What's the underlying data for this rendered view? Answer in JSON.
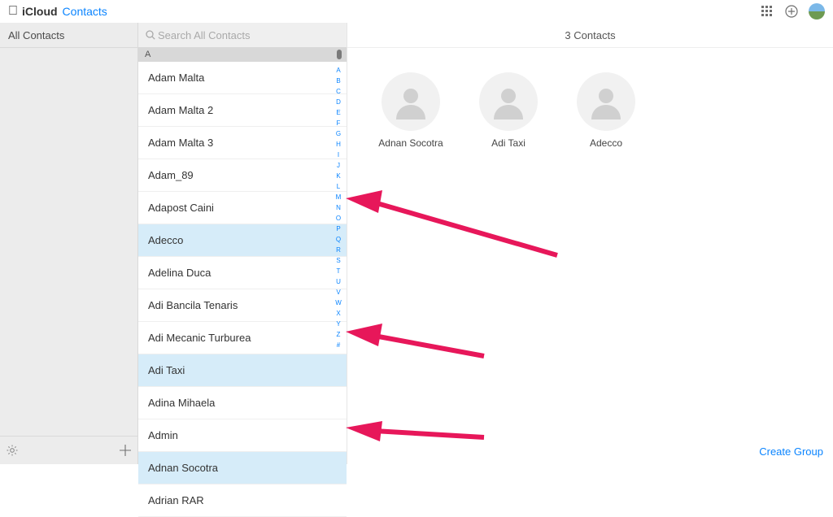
{
  "topbar": {
    "brand_os": "iCloud",
    "brand_app": "Contacts"
  },
  "sidebar": {
    "groups": [
      {
        "label": "All Contacts"
      }
    ]
  },
  "list": {
    "search_placeholder": "Search All Contacts",
    "section_header": "A",
    "rows": [
      {
        "name": "Adam Malta",
        "selected": false
      },
      {
        "name": "Adam Malta 2",
        "selected": false
      },
      {
        "name": "Adam Malta 3",
        "selected": false
      },
      {
        "name": "Adam_89",
        "selected": false
      },
      {
        "name": "Adapost Caini",
        "selected": false
      },
      {
        "name": "Adecco",
        "selected": true
      },
      {
        "name": "Adelina Duca",
        "selected": false
      },
      {
        "name": "Adi Bancila Tenaris",
        "selected": false
      },
      {
        "name": "Adi Mecanic Turburea",
        "selected": false
      },
      {
        "name": "Adi Taxi",
        "selected": true
      },
      {
        "name": "Adina Mihaela",
        "selected": false
      },
      {
        "name": "Admin",
        "selected": false
      },
      {
        "name": "Adnan Socotra",
        "selected": true
      },
      {
        "name": "Adrian RAR",
        "selected": false
      }
    ],
    "alpha_index": [
      "A",
      "B",
      "C",
      "D",
      "E",
      "F",
      "G",
      "H",
      "I",
      "J",
      "K",
      "L",
      "M",
      "N",
      "O",
      "P",
      "Q",
      "R",
      "S",
      "T",
      "U",
      "V",
      "W",
      "X",
      "Y",
      "Z",
      "#"
    ]
  },
  "detail": {
    "header": "3 Contacts",
    "avatars": [
      {
        "name": "Adnan Socotra"
      },
      {
        "name": "Adi Taxi"
      },
      {
        "name": "Adecco"
      }
    ],
    "create_group_label": "Create Group"
  }
}
